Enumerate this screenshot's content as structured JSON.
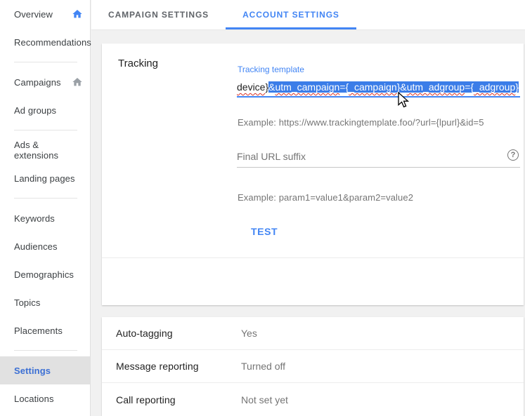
{
  "tabs": {
    "campaign": "CAMPAIGN SETTINGS",
    "account": "ACCOUNT SETTINGS"
  },
  "sidebar": {
    "items": [
      {
        "label": "Overview",
        "icon": "home-icon",
        "icon_color": "#4285f4"
      },
      {
        "label": "Recommendations"
      },
      {
        "label": "Campaigns",
        "icon": "home-icon",
        "icon_color": "#9aa0a6"
      },
      {
        "label": "Ad groups"
      },
      {
        "label": "Ads & extensions"
      },
      {
        "label": "Landing pages"
      },
      {
        "label": "Keywords"
      },
      {
        "label": "Audiences"
      },
      {
        "label": "Demographics"
      },
      {
        "label": "Topics"
      },
      {
        "label": "Placements"
      },
      {
        "label": "Settings",
        "active": true
      },
      {
        "label": "Locations"
      }
    ]
  },
  "tracking": {
    "title": "Tracking",
    "template": {
      "label": "Tracking template",
      "value_visible": "device}&utm_campaign={_campaign}&utm_adgroup={_adgroup}",
      "parts": [
        {
          "text": "device",
          "selected": false,
          "misspelled": true
        },
        {
          "text": "}",
          "selected": false,
          "misspelled": false
        },
        {
          "text": "&",
          "selected": true,
          "misspelled": false
        },
        {
          "text": "utm_campaign",
          "selected": true,
          "misspelled": true
        },
        {
          "text": "={",
          "selected": true,
          "misspelled": false
        },
        {
          "text": "_campaign",
          "selected": true,
          "misspelled": true
        },
        {
          "text": "}&",
          "selected": true,
          "misspelled": false
        },
        {
          "text": "utm_adgroup",
          "selected": true,
          "misspelled": true
        },
        {
          "text": "={",
          "selected": true,
          "misspelled": false
        },
        {
          "text": "_adgroup",
          "selected": true,
          "misspelled": true
        },
        {
          "text": "}",
          "selected": true,
          "misspelled": false
        }
      ],
      "example": "Example: https://www.trackingtemplate.foo/?url={lpurl}&id=5"
    },
    "suffix": {
      "placeholder": "Final URL suffix",
      "example": "Example: param1=value1&param2=value2",
      "help_glyph": "?"
    },
    "test_button": "TEST"
  },
  "account_rows": [
    {
      "label": "Auto-tagging",
      "value": "Yes"
    },
    {
      "label": "Message reporting",
      "value": "Turned off"
    },
    {
      "label": "Call reporting",
      "value": "Not set yet"
    }
  ],
  "icons": {
    "overview": "home-icon",
    "campaigns": "home-icon",
    "suffix_help": "question-mark-circle-icon",
    "pointer": "mouse-cursor-arrow-icon"
  },
  "colors": {
    "accent_blue": "#4285f4",
    "selection_blue": "#3b7de8",
    "misspell_red": "#d93025",
    "active_item_bg": "#e1e1e1",
    "page_bg": "#f1f1f1",
    "text_dark": "#212121",
    "text_gray": "#757575"
  }
}
